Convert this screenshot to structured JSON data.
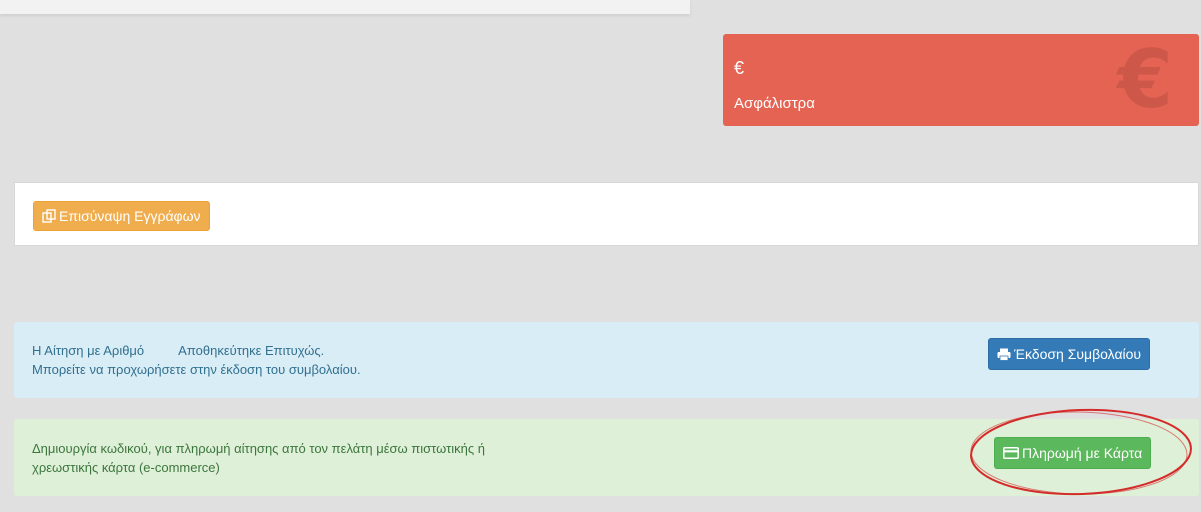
{
  "premium": {
    "value": "€",
    "label": "Ασφάλιστρα",
    "icon": "euro-icon",
    "background_glyph": "€",
    "color": "#e56353"
  },
  "documents": {
    "attach_button_label": "Επισύναψη Εγγράφων",
    "attach_icon": "copy-icon"
  },
  "info": {
    "line1_part1": "Η Αίτηση με Αριθμό",
    "line1_part2": "Αποθηκεύτηκε Επιτυχώς.",
    "line2": "Μπορείτε να προχωρήσετε στην έκδοση του συμβολαίου.",
    "issue_button_label": "Έκδοση Συμβολαίου",
    "issue_icon": "printer-icon"
  },
  "payment": {
    "text_line1": "Δημιουργία κωδικού, για πληρωμή αίτησης από τον πελάτη μέσω πιστωτικής ή",
    "text_line2": "χρεωστικής κάρτα (e-commerce)",
    "pay_button_label": "Πληρωμή με Κάρτα",
    "pay_icon": "credit-card-icon"
  },
  "colors": {
    "attach": "#f0ad4e",
    "issue": "#337ab7",
    "pay": "#5cb85c",
    "annotation": "#d42b2b"
  }
}
